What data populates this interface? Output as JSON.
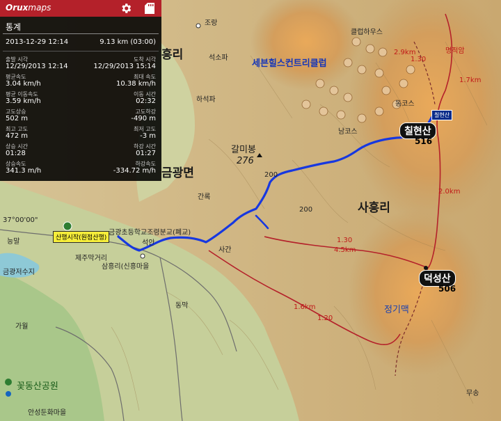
{
  "app": {
    "logo_main": "Orux",
    "logo_sub": "maps",
    "settings_icon": "gear-icon",
    "storage_icon": "sd-card-icon",
    "accent": "#b4212a"
  },
  "stats": {
    "title": "통계",
    "date": "2013-12-29 12:14",
    "distance_time": "9.13 km (03:00)",
    "rows": [
      {
        "left_label": "출발 시각",
        "left_value": "12/29/2013 12:14",
        "right_label": "도착 시각",
        "right_value": "12/29/2013 15:14"
      },
      {
        "left_label": "평균속도",
        "left_value": "3.04 km/h",
        "right_label": "최대 속도",
        "right_value": "10.38 km/h"
      },
      {
        "left_label": "평균 이동속도",
        "left_value": "3.59 km/h",
        "right_label": "이동 시간",
        "right_value": "02:32"
      },
      {
        "left_label": "고도상승",
        "left_value": "502 m",
        "right_label": "고도하강",
        "right_value": "-490 m"
      },
      {
        "left_label": "최고 고도",
        "left_value": "472 m",
        "right_label": "최저 고도",
        "right_value": "-3 m"
      },
      {
        "left_label": "상승 시간",
        "left_value": "01:28",
        "right_label": "하강 시간",
        "right_value": "01:27"
      },
      {
        "left_label": "상승속도",
        "left_value": "341.3 m/h",
        "right_label": "하강속도",
        "right_value": "-334.72 m/h"
      }
    ]
  },
  "map": {
    "peaks": [
      {
        "name": "칠현산",
        "elev": "516"
      },
      {
        "name": "덕성산",
        "elev": "506"
      }
    ],
    "places": {
      "geumgwang": "금광면",
      "sahung": "사흥리",
      "heungri": "흥리",
      "galmibong": "갈미봉",
      "galmibong_elev": "276",
      "resort": "세븐힐스컨트리클럽",
      "club_house": "클럽하우스",
      "jorang": "조랑",
      "seoksopa": "석소파",
      "hasokpa": "하석파",
      "ganrok": "간록",
      "sagan": "사간",
      "seokan": "석안",
      "dongmak": "동막",
      "gaeul": "가월",
      "kkotdong": "꽃동산공원",
      "geumgwang_lake": "금광저수지",
      "sanmeori": "삼흥리(신흥마을",
      "jeju_makgeori": "제주막거리",
      "dunggok": "능말",
      "lat": "37°00'00\"",
      "school": "금광초등학교조령분교(폐교)",
      "start_tag": "산행시작(원점산행)",
      "end_tag": "칠현산",
      "myeongjeok": "명적암",
      "namcourse": "남코스",
      "dongcourse": "동코스",
      "rung": "무송",
      "insung": "안성둔화마을",
      "dist_a": "1.30",
      "dist_b": "4.5km",
      "dist_c": "1.6km",
      "dist_d": "2.9km",
      "dist_e": "1.7km",
      "dist_f": "2.0km",
      "dist_g": "1.30",
      "dist_h": "1.20",
      "contour_200a": "200",
      "contour_200b": "200",
      "trail_label": "정기맥"
    }
  }
}
